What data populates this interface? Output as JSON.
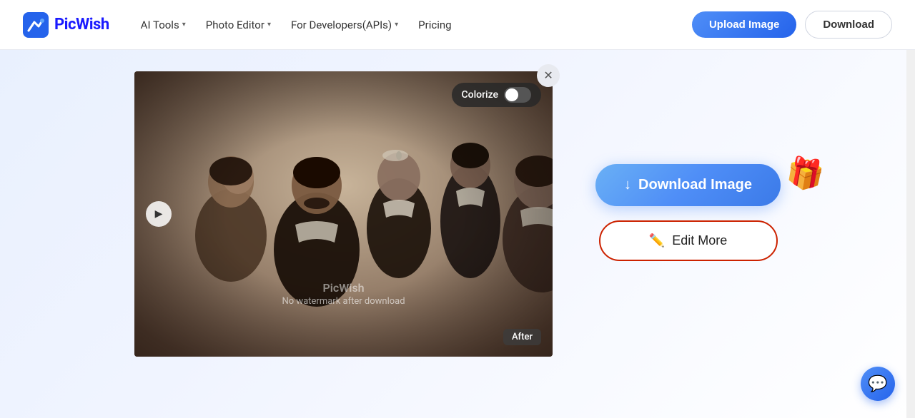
{
  "header": {
    "logo_text": "PicWish",
    "nav": [
      {
        "id": "ai-tools",
        "label": "AI Tools",
        "has_dropdown": true
      },
      {
        "id": "photo-editor",
        "label": "Photo Editor",
        "has_dropdown": true
      },
      {
        "id": "for-developers",
        "label": "For Developers(APIs)",
        "has_dropdown": true
      },
      {
        "id": "pricing",
        "label": "Pricing",
        "has_dropdown": false
      }
    ],
    "upload_label": "Upload Image",
    "download_label": "Download"
  },
  "image_area": {
    "colorize_label": "Colorize",
    "after_badge": "After",
    "watermark_brand": "PicWish",
    "watermark_sub": "No watermark after download"
  },
  "actions": {
    "download_image_label": "Download Image",
    "edit_more_label": "Edit More"
  },
  "chat": {
    "icon": "💬"
  }
}
